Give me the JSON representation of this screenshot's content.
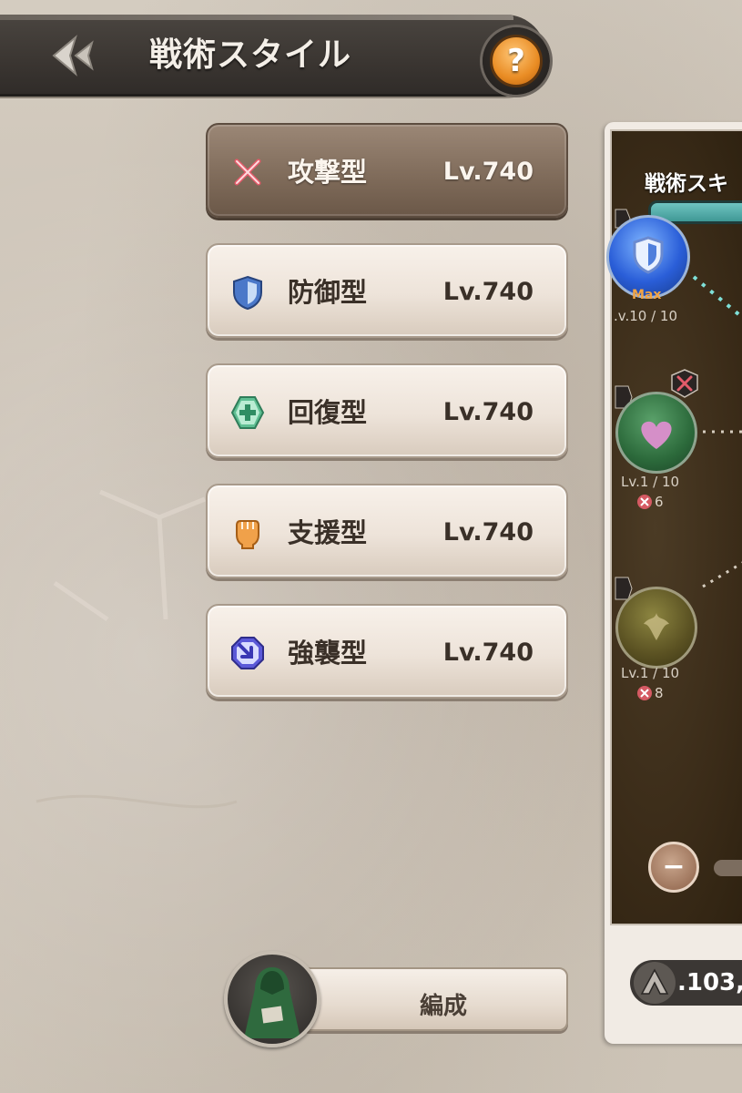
{
  "header": {
    "title": "戦術スタイル",
    "back_icon": "chevron-left-double-icon",
    "help_label": "?"
  },
  "styles": [
    {
      "name": "攻撃型",
      "level": "Lv.740",
      "icon": "crossed-swords-icon",
      "active": true
    },
    {
      "name": "防御型",
      "level": "Lv.740",
      "icon": "shield-icon",
      "active": false
    },
    {
      "name": "回復型",
      "level": "Lv.740",
      "icon": "heal-plus-icon",
      "active": false
    },
    {
      "name": "支援型",
      "level": "Lv.740",
      "icon": "fist-icon",
      "active": false
    },
    {
      "name": "強襲型",
      "level": "Lv.740",
      "icon": "assault-arrow-icon",
      "active": false
    }
  ],
  "skill_panel": {
    "title": "戦術スキ",
    "nodes": [
      {
        "level": ".v.10 / 10",
        "badge": "Max",
        "icon": "shield-icon"
      },
      {
        "level": "Lv.1 / 10",
        "cost": "6",
        "icon": "heart-icon"
      },
      {
        "level": "Lv.1 / 10",
        "cost": "8",
        "icon": "emblem-icon"
      }
    ],
    "zoom_out_label": "−"
  },
  "resource": {
    "value": ".103,"
  },
  "formation": {
    "label": "編成"
  },
  "colors": {
    "accent_orange": "#e98c24",
    "header_dark": "#3a3531",
    "active_item": "#7e6a59",
    "teal_bar": "#3f9895"
  }
}
